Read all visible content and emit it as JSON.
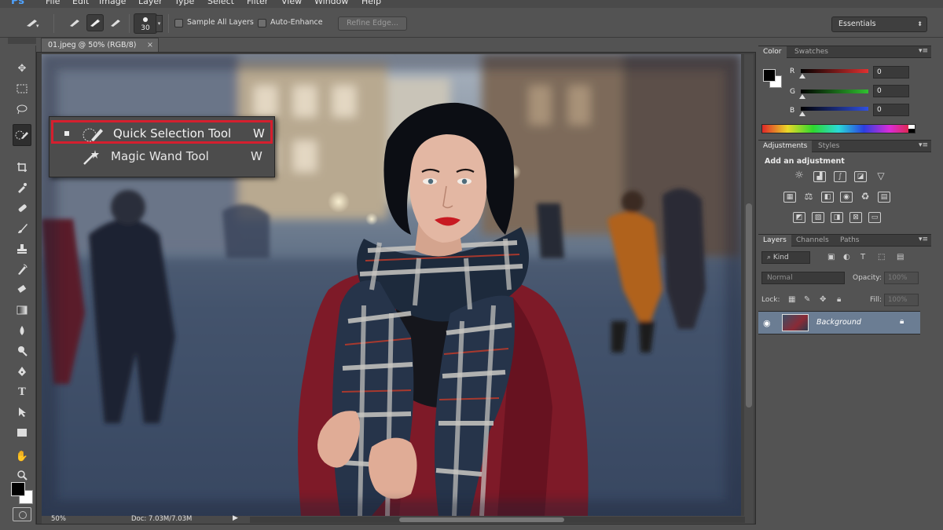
{
  "menubar": {
    "app_logo": "Ps",
    "items": [
      "File",
      "Edit",
      "Image",
      "Layer",
      "Type",
      "Select",
      "Filter",
      "View",
      "Window",
      "Help"
    ]
  },
  "options_bar": {
    "brush_size": "30",
    "sample_all_layers": "Sample All Layers",
    "auto_enhance": "Auto-Enhance",
    "refine_edge": "Refine Edge...",
    "workspace": "Essentials"
  },
  "document": {
    "tab_title": "01.jpeg @ 50% (RGB/8)",
    "zoom": "50%",
    "doc_info": "Doc: 7.03M/7.03M"
  },
  "flyout": {
    "items": [
      {
        "label": "Quick Selection Tool",
        "shortcut": "W",
        "icon": "quick-selection-brush-icon",
        "active": true
      },
      {
        "label": "Magic Wand Tool",
        "shortcut": "W",
        "icon": "magic-wand-icon",
        "active": false
      }
    ]
  },
  "panels": {
    "color": {
      "tabs": [
        "Color",
        "Swatches"
      ],
      "channels": [
        {
          "label": "R",
          "value": "0",
          "color": "#e03030"
        },
        {
          "label": "G",
          "value": "0",
          "color": "#30c030"
        },
        {
          "label": "B",
          "value": "0",
          "color": "#3050e0"
        }
      ]
    },
    "adjustments": {
      "tabs": [
        "Adjustments",
        "Styles"
      ],
      "heading": "Add an adjustment"
    },
    "layers": {
      "tabs": [
        "Layers",
        "Channels",
        "Paths"
      ],
      "kind": "Kind",
      "blend_mode": "Normal",
      "opacity_label": "Opacity:",
      "opacity_value": "100%",
      "lock_label": "Lock:",
      "fill_label": "Fill:",
      "fill_value": "100%",
      "layer_name": "Background"
    }
  },
  "colors": {
    "highlight_border": "#d51f2e",
    "panel_bg": "#535353",
    "selected_layer": "#6b7d93"
  }
}
